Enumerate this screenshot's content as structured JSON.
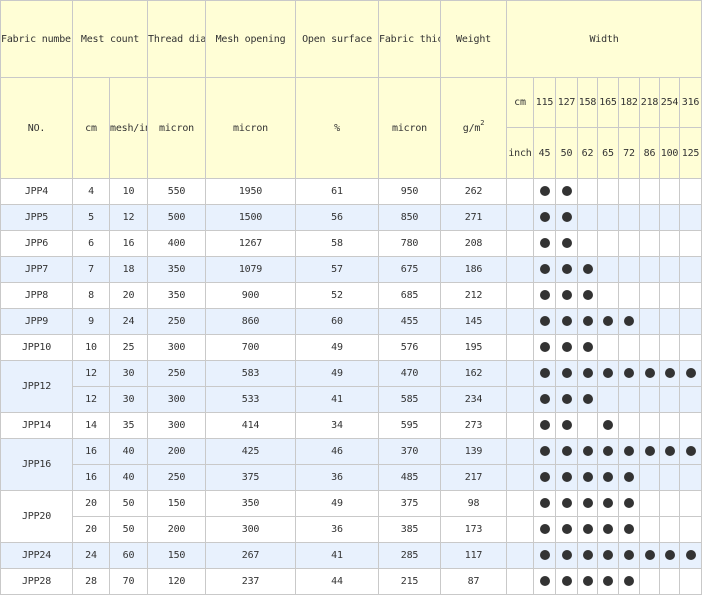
{
  "header": {
    "fabric_number": "Fabric number",
    "mest_count": "Mest count",
    "thread_diameter": "Thread diameter",
    "mesh_opening": "Mesh opening",
    "open_surface": "Open surface",
    "fabric_thickness": "Fabric thickness",
    "weight": "Weight",
    "width": "Width"
  },
  "units": {
    "no": "NO.",
    "cm": "cm",
    "mesh_inch": "mesh/inch",
    "micron_thread": "micron",
    "micron_opening": "micron",
    "percent": "%",
    "micron_thickness": "micron",
    "weight_base": "g/m",
    "weight_exp": "2",
    "width_cm_label": "cm",
    "width_inch_label": "inch"
  },
  "widths": {
    "cm": [
      "115",
      "127",
      "158",
      "165",
      "182",
      "218",
      "254",
      "316"
    ],
    "inch": [
      "45",
      "50",
      "62",
      "65",
      "72",
      "86",
      "100",
      "125"
    ]
  },
  "groups": [
    {
      "no": "JPP4",
      "shade": "white",
      "rows": [
        {
          "cm": "4",
          "mesh": "10",
          "thread": "550",
          "opening": "1950",
          "open": "61",
          "thickness": "950",
          "weight": "262",
          "widths": [
            true,
            true,
            false,
            false,
            false,
            false,
            false,
            false
          ]
        }
      ]
    },
    {
      "no": "JPP5",
      "shade": "blue",
      "rows": [
        {
          "cm": "5",
          "mesh": "12",
          "thread": "500",
          "opening": "1500",
          "open": "56",
          "thickness": "850",
          "weight": "271",
          "widths": [
            true,
            true,
            false,
            false,
            false,
            false,
            false,
            false
          ]
        }
      ]
    },
    {
      "no": "JPP6",
      "shade": "white",
      "rows": [
        {
          "cm": "6",
          "mesh": "16",
          "thread": "400",
          "opening": "1267",
          "open": "58",
          "thickness": "780",
          "weight": "208",
          "widths": [
            true,
            true,
            false,
            false,
            false,
            false,
            false,
            false
          ]
        }
      ]
    },
    {
      "no": "JPP7",
      "shade": "blue",
      "rows": [
        {
          "cm": "7",
          "mesh": "18",
          "thread": "350",
          "opening": "1079",
          "open": "57",
          "thickness": "675",
          "weight": "186",
          "widths": [
            true,
            true,
            true,
            false,
            false,
            false,
            false,
            false
          ]
        }
      ]
    },
    {
      "no": "JPP8",
      "shade": "white",
      "rows": [
        {
          "cm": "8",
          "mesh": "20",
          "thread": "350",
          "opening": "900",
          "open": "52",
          "thickness": "685",
          "weight": "212",
          "widths": [
            true,
            true,
            true,
            false,
            false,
            false,
            false,
            false
          ]
        }
      ]
    },
    {
      "no": "JPP9",
      "shade": "blue",
      "rows": [
        {
          "cm": "9",
          "mesh": "24",
          "thread": "250",
          "opening": "860",
          "open": "60",
          "thickness": "455",
          "weight": "145",
          "widths": [
            true,
            true,
            true,
            true,
            true,
            false,
            false,
            false
          ]
        }
      ]
    },
    {
      "no": "JPP10",
      "shade": "white",
      "rows": [
        {
          "cm": "10",
          "mesh": "25",
          "thread": "300",
          "opening": "700",
          "open": "49",
          "thickness": "576",
          "weight": "195",
          "widths": [
            true,
            true,
            true,
            false,
            false,
            false,
            false,
            false
          ]
        }
      ]
    },
    {
      "no": "JPP12",
      "shade": "blue",
      "rows": [
        {
          "cm": "12",
          "mesh": "30",
          "thread": "250",
          "opening": "583",
          "open": "49",
          "thickness": "470",
          "weight": "162",
          "widths": [
            true,
            true,
            true,
            true,
            true,
            true,
            true,
            true
          ]
        },
        {
          "cm": "12",
          "mesh": "30",
          "thread": "300",
          "opening": "533",
          "open": "41",
          "thickness": "585",
          "weight": "234",
          "widths": [
            true,
            true,
            true,
            false,
            false,
            false,
            false,
            false
          ]
        }
      ]
    },
    {
      "no": "JPP14",
      "shade": "white",
      "rows": [
        {
          "cm": "14",
          "mesh": "35",
          "thread": "300",
          "opening": "414",
          "open": "34",
          "thickness": "595",
          "weight": "273",
          "widths": [
            true,
            true,
            false,
            true,
            false,
            false,
            false,
            false
          ]
        }
      ]
    },
    {
      "no": "JPP16",
      "shade": "blue",
      "rows": [
        {
          "cm": "16",
          "mesh": "40",
          "thread": "200",
          "opening": "425",
          "open": "46",
          "thickness": "370",
          "weight": "139",
          "widths": [
            true,
            true,
            true,
            true,
            true,
            true,
            true,
            true
          ]
        },
        {
          "cm": "16",
          "mesh": "40",
          "thread": "250",
          "opening": "375",
          "open": "36",
          "thickness": "485",
          "weight": "217",
          "widths": [
            true,
            true,
            true,
            true,
            true,
            false,
            false,
            false
          ]
        }
      ]
    },
    {
      "no": "JPP20",
      "shade": "white",
      "rows": [
        {
          "cm": "20",
          "mesh": "50",
          "thread": "150",
          "opening": "350",
          "open": "49",
          "thickness": "375",
          "weight": "98",
          "widths": [
            true,
            true,
            true,
            true,
            true,
            false,
            false,
            false
          ]
        },
        {
          "cm": "20",
          "mesh": "50",
          "thread": "200",
          "opening": "300",
          "open": "36",
          "thickness": "385",
          "weight": "173",
          "widths": [
            true,
            true,
            true,
            true,
            true,
            false,
            false,
            false
          ]
        }
      ]
    },
    {
      "no": "JPP24",
      "shade": "blue",
      "rows": [
        {
          "cm": "24",
          "mesh": "60",
          "thread": "150",
          "opening": "267",
          "open": "41",
          "thickness": "285",
          "weight": "117",
          "widths": [
            true,
            true,
            true,
            true,
            true,
            true,
            true,
            true
          ]
        }
      ]
    },
    {
      "no": "JPP28",
      "shade": "white",
      "rows": [
        {
          "cm": "28",
          "mesh": "70",
          "thread": "120",
          "opening": "237",
          "open": "44",
          "thickness": "215",
          "weight": "87",
          "widths": [
            true,
            true,
            true,
            true,
            true,
            false,
            false,
            false
          ]
        }
      ]
    }
  ]
}
